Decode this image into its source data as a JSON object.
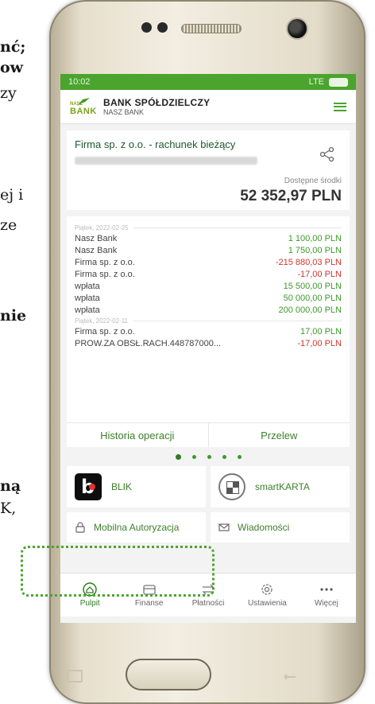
{
  "side_text": {
    "line1": "nć;",
    "line2": "ow",
    "line3": "zy",
    "line4": "ej i",
    "line5": "ze",
    "line6": "nie",
    "line7": "ną",
    "line8": "K,"
  },
  "status_bar": {
    "time": "10:02",
    "signal": "LTE"
  },
  "header": {
    "logo_small": "NASZ",
    "logo_bank": "BANK",
    "bank_name": "BANK SPÓŁDZIELCZY",
    "bank_sub": "NASZ BANK"
  },
  "account": {
    "name": "Firma sp. z o.o. - rachunek bieżący",
    "available_label": "Dostępne środki",
    "available_amount": "52 352,97 PLN"
  },
  "transactions": {
    "groups": [
      {
        "date": "Piątek, 2022-02-25",
        "rows": [
          {
            "name": "Nasz Bank",
            "amount": "1 100,00 PLN",
            "sign": "pos"
          },
          {
            "name": "Nasz Bank",
            "amount": "1 750,00 PLN",
            "sign": "pos"
          },
          {
            "name": "Firma sp. z o.o.",
            "amount": "-215 880,03 PLN",
            "sign": "neg"
          },
          {
            "name": "Firma sp. z o.o.",
            "amount": "-17,00 PLN",
            "sign": "neg"
          },
          {
            "name": "wpłata",
            "amount": "15 500,00 PLN",
            "sign": "pos"
          },
          {
            "name": "wpłata",
            "amount": "50 000,00 PLN",
            "sign": "pos"
          },
          {
            "name": "wpłata",
            "amount": "200 000,00 PLN",
            "sign": "pos"
          }
        ]
      },
      {
        "date": "Piątek, 2022-02-11",
        "rows": [
          {
            "name": "Firma sp. z o.o.",
            "amount": "17,00 PLN",
            "sign": "pos"
          },
          {
            "name": "PROW.ZA OBSŁ.RACH.448787000...",
            "amount": "-17,00 PLN",
            "sign": "neg"
          }
        ]
      }
    ],
    "history_label": "Historia operacji",
    "transfer_label": "Przelew"
  },
  "tiles": {
    "blik": "BLIK",
    "smartkarta": "smartKARTA",
    "mobile_auth": "Mobilna Autoryzacja",
    "messages": "Wiadomości"
  },
  "nav": {
    "items": [
      {
        "label": "Pulpit",
        "icon": "home-icon",
        "active": true
      },
      {
        "label": "Finanse",
        "icon": "wallet-icon",
        "active": false
      },
      {
        "label": "Płatności",
        "icon": "transfer-icon",
        "active": false
      },
      {
        "label": "Ustawienia",
        "icon": "gear-icon",
        "active": false
      },
      {
        "label": "Więcej",
        "icon": "more-icon",
        "active": false
      }
    ]
  },
  "colors": {
    "brand_green": "#4aa42e",
    "positive": "#3d9a2a",
    "negative": "#d0352a"
  }
}
